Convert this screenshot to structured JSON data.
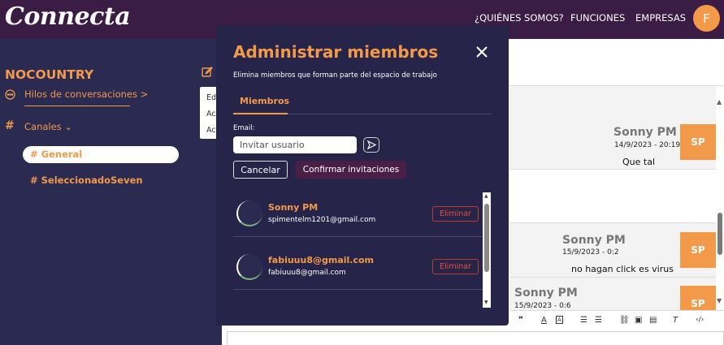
{
  "app": {
    "logo": "Connecta"
  },
  "nav": {
    "items": [
      "¿QUIÉNES SOMOS?",
      "FUNCIONES",
      "EMPRESAS"
    ],
    "avatar_initial": "F"
  },
  "sidebar": {
    "workspace": "NOCOUNTRY",
    "threads_label": "Hilos de conversaciones >",
    "channels_label": "Canales ⌄",
    "channels": [
      "# General",
      "# SeleccionadoSeven"
    ],
    "active_channel": "# General",
    "popup_items": [
      "Ed",
      "Ac",
      "Ac"
    ]
  },
  "chat": {
    "messages": [
      {
        "name": "Sonny PM",
        "date": "14/9/2023 - 20:19",
        "text": "Que tal",
        "avatar": "SP"
      },
      {
        "name": "Sonny PM",
        "date": "15/9/2023 - 0:2",
        "text": "no hagan click es virus",
        "avatar": "SP"
      },
      {
        "name": "Sonny PM",
        "date": "15/9/2023 - 0:6",
        "text": "",
        "avatar": "SP"
      }
    ],
    "toolbar_icons": [
      "quote-icon",
      "font-color-icon",
      "highlight-icon",
      "ordered-list-icon",
      "bullet-list-icon",
      "link-icon",
      "image-icon",
      "video-icon",
      "clear-format-icon",
      "code-icon"
    ]
  },
  "modal": {
    "title": "Administrar miembros",
    "subtitle": "Elimina miembros que forman parte del espacio de trabajo",
    "tab": "Miembros",
    "email_label": "Email:",
    "input_placeholder": "Invitar usuario",
    "cancel_label": "Cancelar",
    "confirm_label": "Confirmar invitaciones",
    "members": [
      {
        "name": "Sonny PM",
        "email": "spimentelm1201@gmail.com",
        "delete_label": "Eliminar"
      },
      {
        "name": "fabiuuu8@gmail.com",
        "email": "fabiuuu8@gmail.com",
        "delete_label": "Eliminar"
      }
    ]
  },
  "colors": {
    "accent": "#f2994a",
    "topbar": "#3b1c45",
    "sidebar": "#2b2a50",
    "modal": "#262549"
  }
}
